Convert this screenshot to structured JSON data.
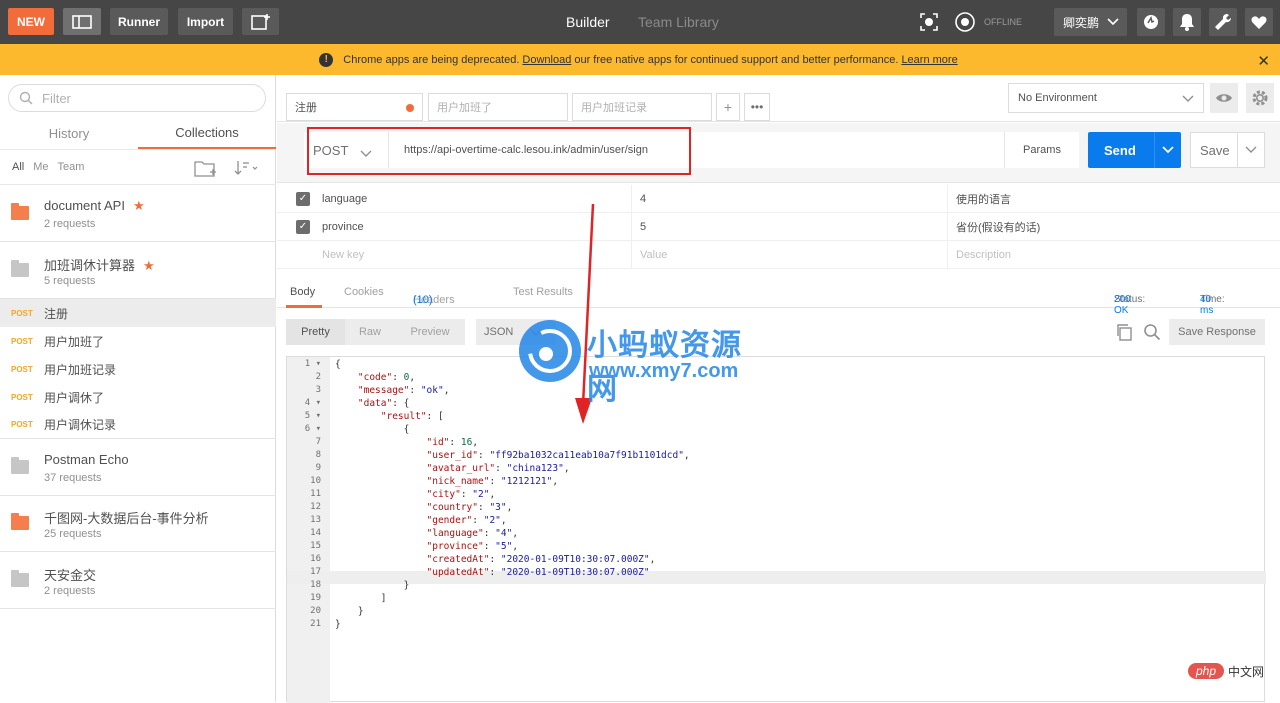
{
  "topbar": {
    "new": "NEW",
    "runner": "Runner",
    "import": "Import",
    "builder": "Builder",
    "team_library": "Team Library",
    "offline": "OFFLINE",
    "user": "卿奕鹏"
  },
  "banner": {
    "text_before": "Chrome apps are being deprecated.",
    "download": "Download",
    "text_after": "our free native apps for continued support and better performance.",
    "learn_more": "Learn more"
  },
  "sidebar": {
    "filter_placeholder": "Filter",
    "tab_history": "History",
    "tab_collections": "Collections",
    "filter_all": "All",
    "filter_me": "Me",
    "filter_team": "Team",
    "collections": [
      {
        "name": "document API",
        "count": "2 requests"
      },
      {
        "name": "加班调休计算器",
        "count": "5 requests"
      },
      {
        "name": "Postman Echo",
        "count": "37 requests"
      },
      {
        "name": "千图网-大数据后台-事件分析",
        "count": "25 requests"
      },
      {
        "name": "天安金交",
        "count": "2 requests"
      }
    ],
    "requests": [
      {
        "method": "POST",
        "name": "注册"
      },
      {
        "method": "POST",
        "name": "用户加班了"
      },
      {
        "method": "POST",
        "name": "用户加班记录"
      },
      {
        "method": "POST",
        "name": "用户调休了"
      },
      {
        "method": "POST",
        "name": "用户调休记录"
      }
    ]
  },
  "tabs": [
    {
      "label": "注册"
    },
    {
      "label": "用户加班了"
    },
    {
      "label": "用户加班记录"
    }
  ],
  "environment": "No Environment",
  "request": {
    "method": "POST",
    "url": "https://api-overtime-calc.lesou.ink/admin/user/sign",
    "params": "Params",
    "send": "Send",
    "save": "Save"
  },
  "body_rows": [
    {
      "key": "language",
      "value": "4",
      "desc": "使用的语言"
    },
    {
      "key": "province",
      "value": "5",
      "desc": "省份(假设有的话)"
    }
  ],
  "new_row": {
    "key": "New key",
    "value": "Value",
    "desc": "Description"
  },
  "response": {
    "tab_body": "Body",
    "tab_cookies": "Cookies",
    "tab_headers": "Headers",
    "headers_count": "(10)",
    "tab_tests": "Test Results",
    "status_label": "Status:",
    "status_value": "200 OK",
    "time_label": "Time:",
    "time_value": "40 ms",
    "pretty": "Pretty",
    "raw": "Raw",
    "preview": "Preview",
    "format": "JSON",
    "save_response": "Save Response"
  },
  "code_lines": [
    "{",
    "    \"code\": 0,",
    "    \"message\": \"ok\",",
    "    \"data\": {",
    "        \"result\": [",
    "            {",
    "                \"id\": 16,",
    "                \"user_id\": \"ff92ba1032ca11eab10a7f91b1101dcd\",",
    "                \"avatar_url\": \"china123\",",
    "                \"nick_name\": \"1212121\",",
    "                \"city\": \"2\",",
    "                \"country\": \"3\",",
    "                \"gender\": \"2\",",
    "                \"language\": \"4\",",
    "                \"province\": \"5\",",
    "                \"createdAt\": \"2020-01-09T10:30:07.000Z\",",
    "                \"updatedAt\": \"2020-01-09T10:30:07.000Z\"",
    "            }",
    "        ]",
    "    }",
    "}"
  ],
  "watermark": {
    "title": "小蚂蚁资源网",
    "url": "www.xmy7.com"
  },
  "php_badge": {
    "logo": "php",
    "text": "中文网"
  },
  "colors": {
    "topbar": "#464646",
    "accent": "#f26b3a",
    "send": "#097bed",
    "banner": "#fdb92e",
    "arrow": "#e02424"
  }
}
